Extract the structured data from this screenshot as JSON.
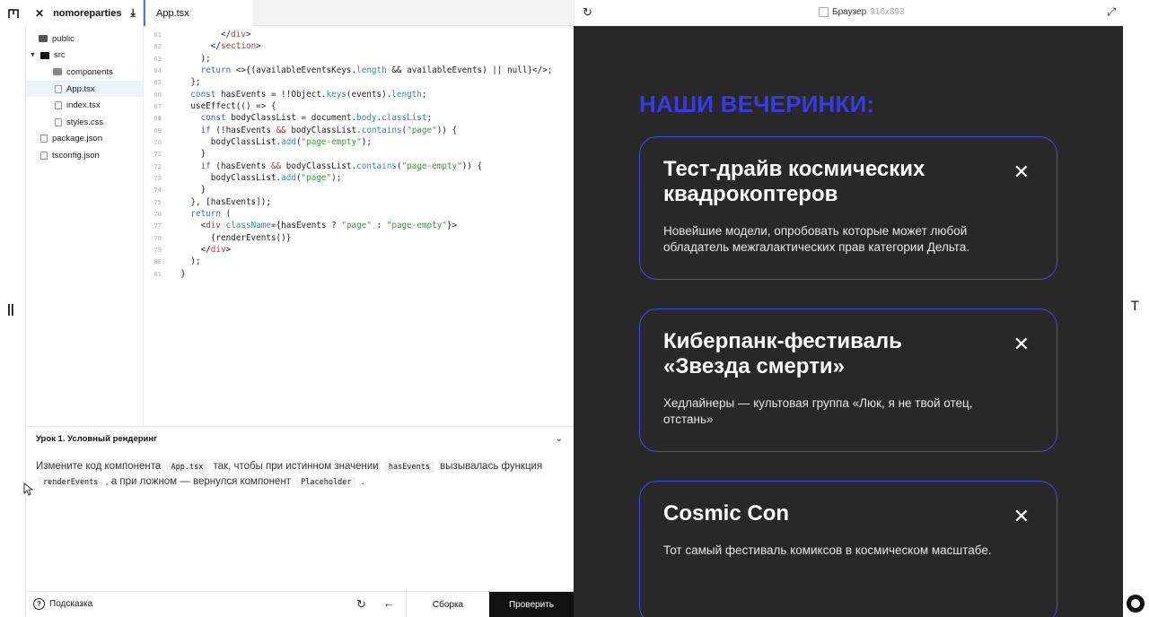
{
  "tabs": {
    "project_name": "nomoreparties",
    "file_tab": "App.tsx"
  },
  "tree": [
    {
      "label": "public",
      "type": "folder"
    },
    {
      "label": "src",
      "type": "folder-open"
    },
    {
      "label": "components",
      "type": "subfolder"
    },
    {
      "label": "App.tsx",
      "type": "file",
      "active": true
    },
    {
      "label": "index.tsx",
      "type": "file"
    },
    {
      "label": "styles.css",
      "type": "file"
    },
    {
      "label": "package.json",
      "type": "rootfile"
    },
    {
      "label": "tsconfig.json",
      "type": "rootfile"
    }
  ],
  "code_lines": [
    {
      "n": "61",
      "html": "          &lt;/<span class=\"tag\">div</span>&gt;"
    },
    {
      "n": "62",
      "html": "        &lt;/<span class=\"tag\">section</span>&gt;"
    },
    {
      "n": "63",
      "html": "      );"
    },
    {
      "n": "64",
      "html": "      <span class=\"kw\">return</span> &lt;&gt;{(availableEventsKeys.<span class=\"prop\">length</span> &amp;&amp; availableEvents) || null}&lt;/&gt;;"
    },
    {
      "n": "65",
      "html": "    };"
    },
    {
      "n": "66",
      "html": "    <span class=\"kw\">const</span> hasEvents = !!Object.<span class=\"prop\">keys</span>(events).<span class=\"prop\">length</span>;"
    },
    {
      "n": "67",
      "html": "    useEffect(() =&gt; {"
    },
    {
      "n": "68",
      "html": "      <span class=\"kw\">const</span> bodyClassList = document.<span class=\"prop\">body</span>.<span class=\"prop\">classList</span>;"
    },
    {
      "n": "69",
      "html": "      <span class=\"kw\">if</span> (!hasEvents <span class=\"tag\">&amp;&amp;</span> bodyClassList.<span class=\"prop\">contains</span>(<span class=\"str\">\"page\"</span>)) {"
    },
    {
      "n": "70",
      "html": "        bodyClassList.<span class=\"prop\">add</span>(<span class=\"str\">\"page-empty\"</span>);"
    },
    {
      "n": "71",
      "html": "      }"
    },
    {
      "n": "72",
      "html": "      <span class=\"kw\">if</span> (hasEvents <span class=\"tag\">&amp;&amp;</span> bodyClassList.<span class=\"prop\">contains</span>(<span class=\"str\">\"page-empty\"</span>)) {"
    },
    {
      "n": "73",
      "html": "        bodyClassList.<span class=\"prop\">add</span>(<span class=\"str\">\"page\"</span>);"
    },
    {
      "n": "74",
      "html": "      }"
    },
    {
      "n": "75",
      "html": "    }, [hasEvents]);"
    },
    {
      "n": "76",
      "html": "    <span class=\"kw\">return</span> ("
    },
    {
      "n": "77",
      "html": "      &lt;<span class=\"tag\">div</span> <span class=\"prop\">className</span>={hasEvents ? <span class=\"str\">\"page\"</span> : <span class=\"str\">\"page-empty\"</span>}&gt;"
    },
    {
      "n": "78",
      "html": "        {renderEvents()}"
    },
    {
      "n": "79",
      "html": "      &lt;/<span class=\"tag\">div</span>&gt;"
    },
    {
      "n": "80",
      "html": "    );"
    },
    {
      "n": "81",
      "html": "  }"
    }
  ],
  "lesson": {
    "title": "Урок 1. Условный рендеринг",
    "t1": "Измените код компонента",
    "c1": "App.tsx",
    "t2": "так, чтобы при истинном значении",
    "c2": "hasEvents",
    "t3": "вызывалась функция",
    "c3": "renderEvents",
    "t4": ", а при ложном — вернулся компонент",
    "c4": "Placeholder",
    "t5": "."
  },
  "bottom": {
    "hint": "Подсказка",
    "build": "Сборка",
    "check": "Проверить"
  },
  "browser": {
    "title": "Браузер",
    "size": "916x893",
    "heading": "НАШИ ВЕЧЕРИНКИ:",
    "cards": [
      {
        "title": "Тест-драйв космических квадрокоптеров",
        "desc": "Новейшие модели, опробовать которые может любой обладатель межгалактических прав категории Дельта."
      },
      {
        "title": "Киберпанк-фестиваль «Звезда смерти»",
        "desc": "Хедлайнеры — культовая группа «Люк, я не твой отец, отстань»"
      },
      {
        "title": "Cosmic Con",
        "desc": "Тот самый фестиваль комиксов в космическом масштабе."
      }
    ]
  },
  "colors": {
    "accent": "#3a3ae0",
    "card_border": "#4a4ad8",
    "browser_bg": "#282828",
    "active_tab": "#4a76d9"
  }
}
